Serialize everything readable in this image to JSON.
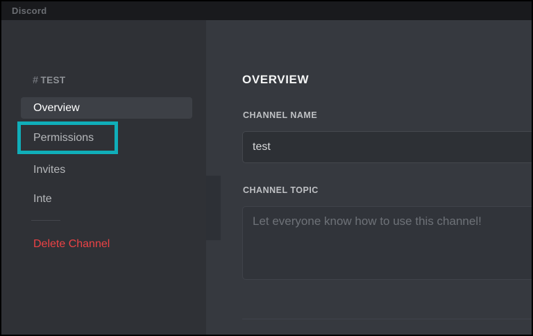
{
  "window": {
    "title": "Discord"
  },
  "sidebar": {
    "channel_header": {
      "hash": "#",
      "name": "TEST"
    },
    "items": [
      {
        "label": "Overview",
        "selected": true
      },
      {
        "label": "Permissions",
        "annotated": true
      },
      {
        "label": "Invites"
      },
      {
        "label": "Inte"
      }
    ],
    "delete_label": "Delete Channel"
  },
  "main": {
    "heading": "OVERVIEW",
    "channel_name": {
      "label": "CHANNEL NAME",
      "value": "test"
    },
    "channel_topic": {
      "label": "CHANNEL TOPIC",
      "placeholder": "Let everyone know how to use this channel!"
    }
  },
  "annotation": {
    "type": "highlight-box",
    "target": "Permissions"
  },
  "colors": {
    "accent_teal": "#10aeb9",
    "danger_red": "#ed4245",
    "sidebar_bg": "#2f3136",
    "main_bg": "#36393f",
    "titlebar_bg": "#191a1d"
  }
}
